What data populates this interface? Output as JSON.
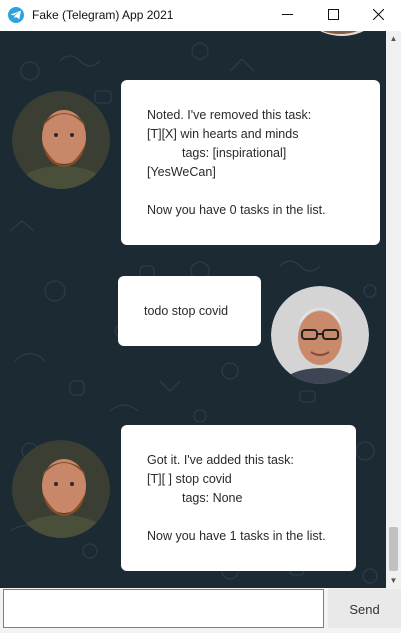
{
  "window": {
    "title": "Fake (Telegram) App 2021",
    "minimize_glyph": "—",
    "maximize_glyph": "☐",
    "close_glyph": "✕"
  },
  "messages": [
    {
      "sender": "bot",
      "lines": [
        "Noted. I've removed this task:",
        "[T][X] win hearts and minds",
        "tags: [inspirational]",
        "[YesWeCan]",
        "",
        "Now you have 0 tasks in the list."
      ]
    },
    {
      "sender": "user",
      "lines": [
        "todo stop covid"
      ]
    },
    {
      "sender": "bot",
      "lines": [
        "Got it. I've added this task:",
        "[T][ ] stop covid",
        "tags: None",
        "",
        "Now you have 1 tasks in the list."
      ]
    }
  ],
  "input": {
    "value": "",
    "placeholder": ""
  },
  "send_button": {
    "label": "Send"
  },
  "colors": {
    "chat_background": "#1c2a34",
    "bubble": "#ffffff",
    "input_focus_border": "#3e8fd6",
    "app_icon": "#2aa3de"
  }
}
